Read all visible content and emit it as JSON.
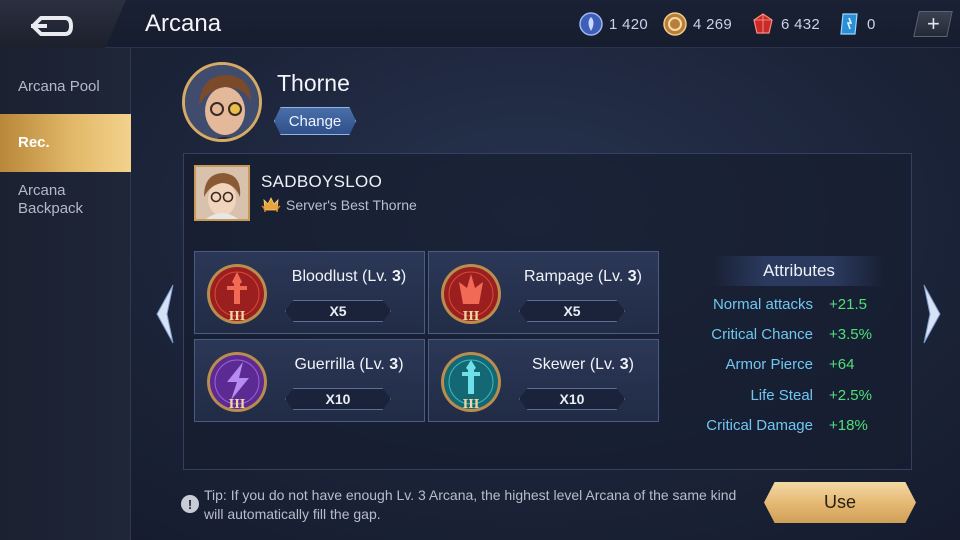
{
  "header": {
    "title": "Arcana",
    "currencies": [
      {
        "icon": "blue-gem-coin-icon",
        "value": "1 420"
      },
      {
        "icon": "gold-coin-icon",
        "value": "4 269"
      },
      {
        "icon": "red-diamond-icon",
        "value": "6 432"
      },
      {
        "icon": "blue-voucher-icon",
        "value": "0"
      }
    ],
    "add_label": "+"
  },
  "sidebar": {
    "items": [
      {
        "label": "Arcana Pool",
        "active": false
      },
      {
        "label": "Rec.",
        "active": true
      },
      {
        "label": "Arcana Backpack",
        "active": false
      }
    ]
  },
  "hero": {
    "name": "Thorne",
    "change_label": "Change"
  },
  "player": {
    "name": "SADBOYSLOO",
    "badge_icon": "crown-wings-icon",
    "badge": "Server's Best Thorne"
  },
  "arcana": [
    {
      "name": "Bloodlust (Lv.",
      "level": "3",
      "close": ")",
      "qty": "X5",
      "color": "red",
      "tier": "III",
      "icon": "red-dagger-arcana-icon"
    },
    {
      "name": "Rampage (Lv.",
      "level": "3",
      "close": ")",
      "qty": "X5",
      "color": "red",
      "tier": "III",
      "icon": "red-flame-arcana-icon"
    },
    {
      "name": "Guerrilla (Lv.",
      "level": "3",
      "close": ")",
      "qty": "X10",
      "color": "purple",
      "tier": "III",
      "icon": "purple-lightning-arcana-icon"
    },
    {
      "name": "Skewer (Lv.",
      "level": "3",
      "close": ")",
      "qty": "X10",
      "color": "teal",
      "tier": "III",
      "icon": "teal-dagger-arcana-icon"
    }
  ],
  "attributes": {
    "title": "Attributes",
    "rows": [
      {
        "label": "Normal attacks",
        "value": "+21.5"
      },
      {
        "label": "Critical Chance",
        "value": "+3.5%"
      },
      {
        "label": "Armor Pierce",
        "value": "+64"
      },
      {
        "label": "Life Steal",
        "value": "+2.5%"
      },
      {
        "label": "Critical Damage",
        "value": "+18%"
      }
    ]
  },
  "footer": {
    "tip_icon": "!",
    "tip": "Tip: If you do not have enough Lv. 3 Arcana, the highest level Arcana of the same kind will automatically fill the gap.",
    "use_label": "Use"
  },
  "colors": {
    "accent_gold": "#e4b771",
    "attr_label": "#6fc7f2",
    "attr_value": "#4fe07a",
    "red_arcana": "#b52a2a",
    "purple_arcana": "#6e3aa8",
    "teal_arcana": "#1f8a9a"
  }
}
